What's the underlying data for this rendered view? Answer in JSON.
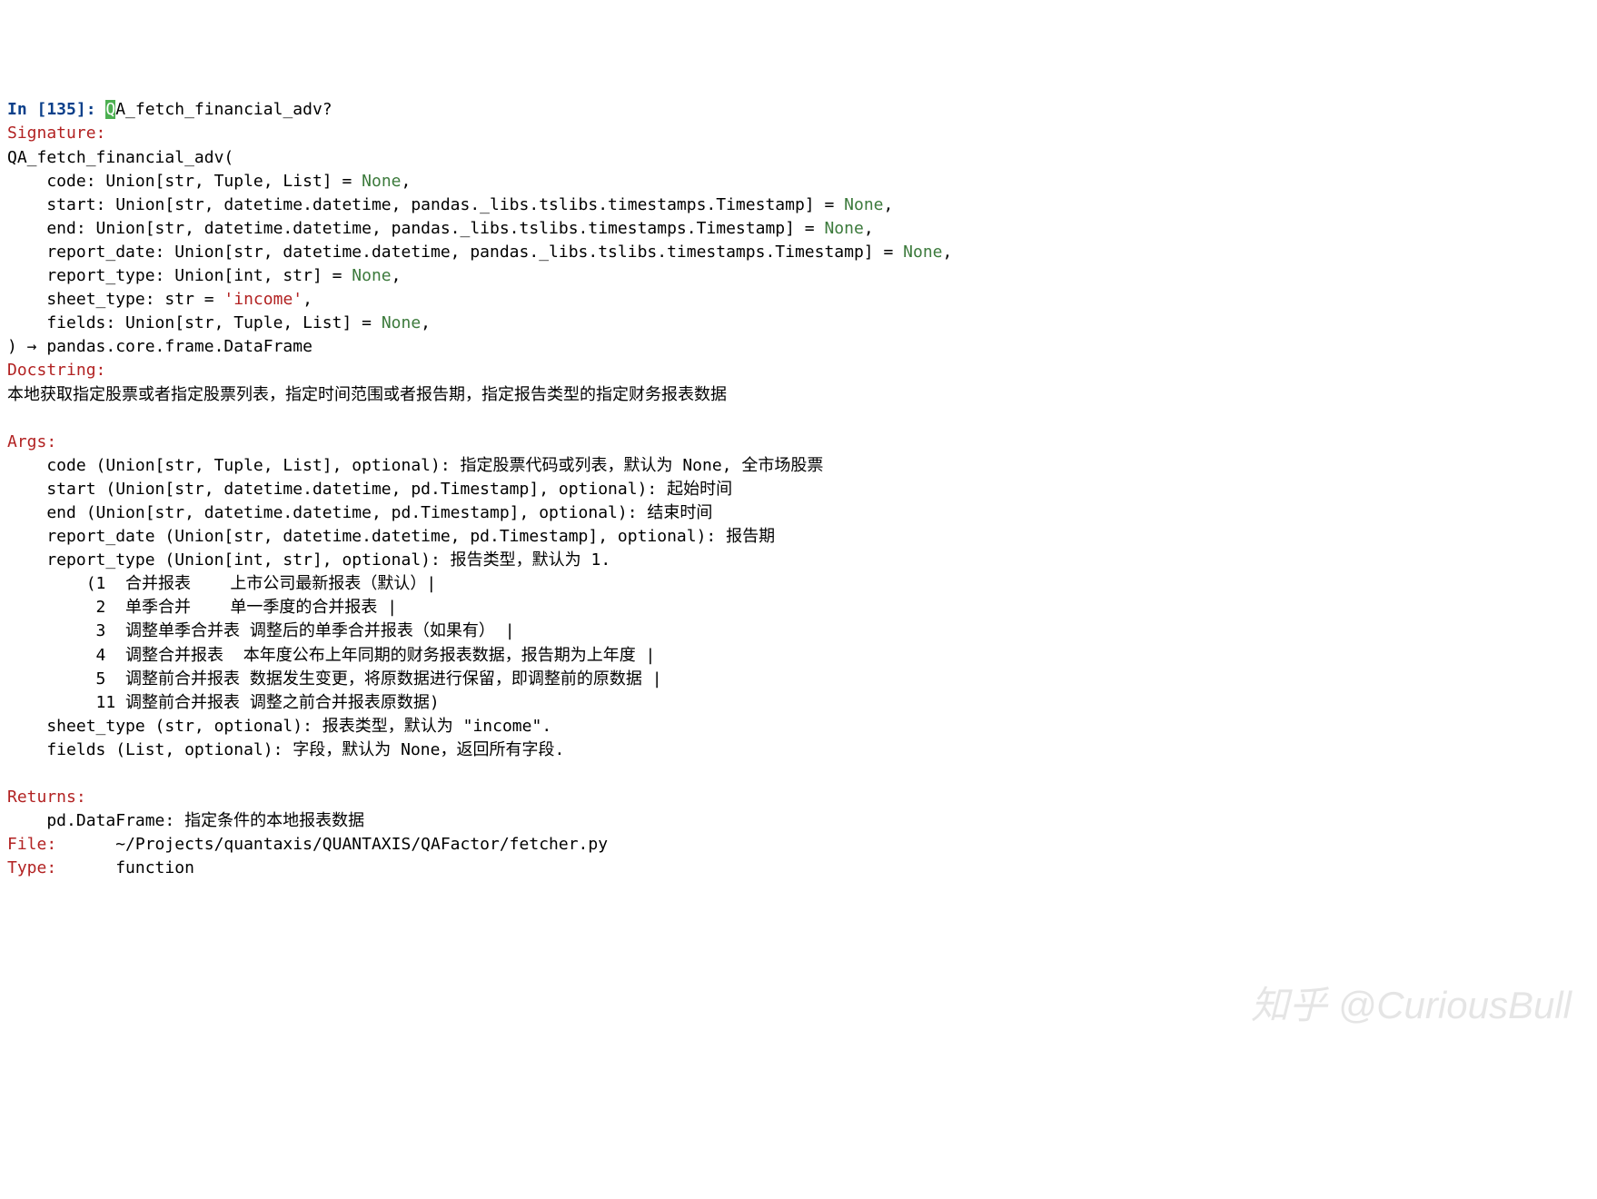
{
  "prompt": {
    "label": "In [135]: ",
    "cursor_char": "Q",
    "rest": "A_fetch_financial_adv?"
  },
  "signature": {
    "header": "Signature:",
    "fn": "QA_fetch_financial_adv(",
    "params": [
      {
        "pre": "    code: Union[str, Tuple, List] = ",
        "none": "None",
        "post": ","
      },
      {
        "pre": "    start: Union[str, datetime.datetime, pandas._libs.tslibs.timestamps.Timestamp] = ",
        "none": "None",
        "post": ","
      },
      {
        "pre": "    end: Union[str, datetime.datetime, pandas._libs.tslibs.timestamps.Timestamp] = ",
        "none": "None",
        "post": ","
      },
      {
        "pre": "    report_date: Union[str, datetime.datetime, pandas._libs.tslibs.timestamps.Timestamp] = ",
        "none": "None",
        "post": ","
      },
      {
        "pre": "    report_type: Union[int, str] = ",
        "none": "None",
        "post": ","
      },
      {
        "pre": "    sheet_type: str = ",
        "str": "'income'",
        "post": ","
      },
      {
        "pre": "    fields: Union[str, Tuple, List] = ",
        "none": "None",
        "post": ","
      }
    ],
    "close": ") → pandas.core.frame.DataFrame"
  },
  "docstring": {
    "header": "Docstring:",
    "summary": "本地获取指定股票或者指定股票列表，指定时间范围或者报告期，指定报告类型的指定财务报表数据",
    "args_header": "Args:",
    "args": [
      "    code (Union[str, Tuple, List], optional): 指定股票代码或列表，默认为 None, 全市场股票",
      "    start (Union[str, datetime.datetime, pd.Timestamp], optional): 起始时间",
      "    end (Union[str, datetime.datetime, pd.Timestamp], optional): 结束时间",
      "    report_date (Union[str, datetime.datetime, pd.Timestamp], optional): 报告期",
      "    report_type (Union[int, str], optional): 报告类型，默认为 1.",
      "        (1  合并报表    上市公司最新报表（默认）|",
      "         2  单季合并    单一季度的合并报表 |",
      "         3  调整单季合并表 调整后的单季合并报表（如果有） |",
      "         4  调整合并报表  本年度公布上年同期的财务报表数据，报告期为上年度 |",
      "         5  调整前合并报表 数据发生变更，将原数据进行保留，即调整前的原数据 |",
      "         11 调整前合并报表 调整之前合并报表原数据)",
      "    sheet_type (str, optional): 报表类型，默认为 \"income\".",
      "    fields (List, optional): 字段，默认为 None，返回所有字段."
    ],
    "returns_header": "Returns:",
    "returns": "    pd.DataFrame: 指定条件的本地报表数据"
  },
  "file": {
    "label": "File:",
    "value": "      ~/Projects/quantaxis/QUANTAXIS/QAFactor/fetcher.py"
  },
  "type": {
    "label": "Type:",
    "value": "      function"
  },
  "watermark": "知乎 @CuriousBull"
}
